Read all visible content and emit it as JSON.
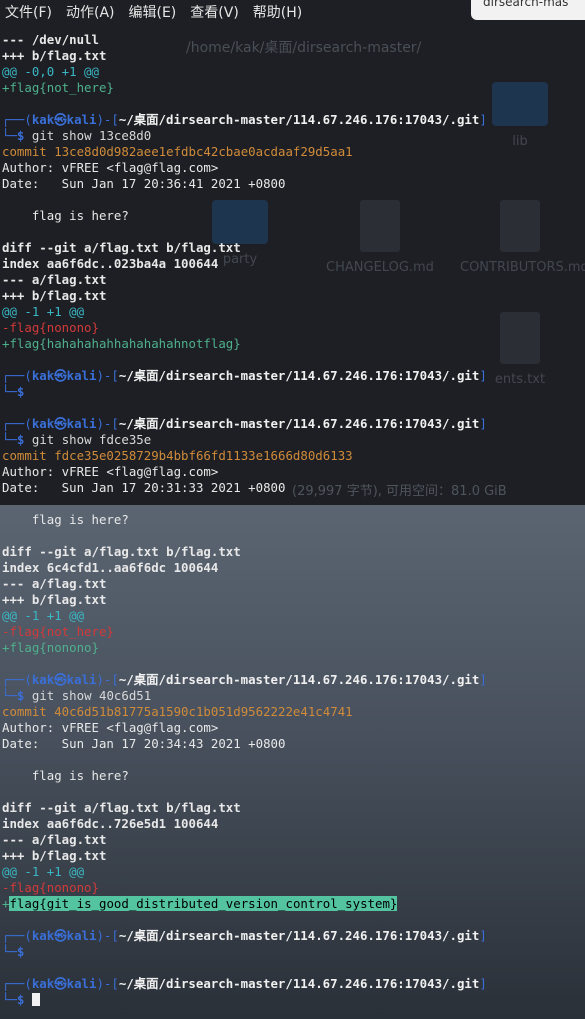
{
  "menu": {
    "items": [
      "文件(F)",
      "动作(A)",
      "编辑(E)",
      "查看(V)",
      "帮助(H)"
    ],
    "topright_fragment": "dirsearch-mas"
  },
  "background": {
    "path": "/home/kak/桌面/dirsearch-master/",
    "status": "(29,997 字节), 可用空间：81.0 GiB",
    "files": [
      "lib",
      "CHANGELOG.md",
      "CONTRIBUTORS.md",
      "party",
      "ents.txt"
    ]
  },
  "prompt": {
    "open": "┌──(",
    "user": "kak",
    "at": "㉿",
    "host": "kali",
    "sep": ")-[",
    "path": "~/桌面/dirsearch-master/114.67.246.176:17043/.git",
    "close": "]",
    "corner": "└─",
    "dollar": "$"
  },
  "terminal": {
    "l1": "--- /dev/null",
    "l2": "+++ b/flag.txt",
    "l3": "@@ -0,0 +1 @@",
    "l4": "+flag{not_here}",
    "cmd1": "git show 13ce8d0",
    "c1_commit": "commit 13ce8d0d982aee1efdbc42cbae0acdaaf29d5aa1",
    "c1_author": "Author: vFREE <flag@flag.com>",
    "c1_date": "Date:   Sun Jan 17 20:36:41 2021 +0800",
    "c1_msg": "    flag is here?",
    "c1_diff": "diff --git a/flag.txt b/flag.txt",
    "c1_index": "index aa6f6dc..023ba4a 100644",
    "c1_minus": "--- a/flag.txt",
    "c1_plus": "+++ b/flag.txt",
    "c1_hunk": "@@ -1 +1 @@",
    "c1_del": "-flag{nonono}",
    "c1_add": "+flag{hahahahahhahahahahnotflag}",
    "cmd2": "git show fdce35e",
    "c2_commit": "commit fdce35e0258729b4bbf66fd1133e1666d80d6133",
    "c2_author": "Author: vFREE <flag@flag.com>",
    "c2_date": "Date:   Sun Jan 17 20:31:33 2021 +0800",
    "c2_msg": "    flag is here?",
    "c2_diff": "diff --git a/flag.txt b/flag.txt",
    "c2_index": "index 6c4cfd1..aa6f6dc 100644",
    "c2_minus": "--- a/flag.txt",
    "c2_plus": "+++ b/flag.txt",
    "c2_hunk": "@@ -1 +1 @@",
    "c2_del": "-flag{not_here}",
    "c2_add": "+flag{nonono}",
    "cmd3": "git show 40c6d51",
    "c3_commit": "commit 40c6d51b81775a1590c1b051d9562222e41c4741",
    "c3_author": "Author: vFREE <flag@flag.com>",
    "c3_date": "Date:   Sun Jan 17 20:34:43 2021 +0800",
    "c3_msg": "    flag is here?",
    "c3_diff": "diff --git a/flag.txt b/flag.txt",
    "c3_index": "index aa6f6dc..726e5d1 100644",
    "c3_minus": "--- a/flag.txt",
    "c3_plus": "+++ b/flag.txt",
    "c3_hunk": "@@ -1 +1 @@",
    "c3_del": "-flag{nonono}",
    "c3_add_sign": "+",
    "c3_add_flag": "flag{git_is_good_distributed_version_control_system}"
  },
  "colors": {
    "prompt_blue": "#3a6fd8",
    "commit_orange": "#d08b3a",
    "hunk_cyan": "#3ab7c5",
    "del_red": "#d23a3a",
    "add_green": "#4fb08c",
    "highlight": "#54c4a0"
  }
}
